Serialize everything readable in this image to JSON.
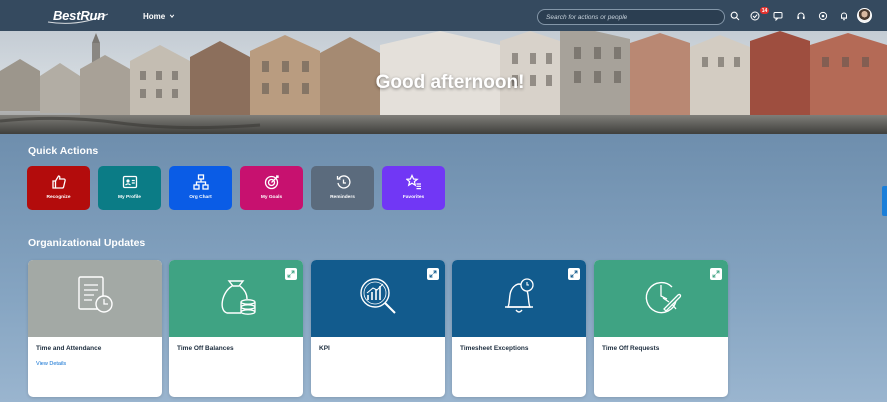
{
  "shell": {
    "logo": "BestRun",
    "home_menu": "Home",
    "search_placeholder": "Search for actions or people",
    "notification_count": "14",
    "icons": [
      "search-icon",
      "notification-check-icon",
      "chat-icon",
      "headset-icon",
      "settings-icon",
      "bell-icon"
    ]
  },
  "hero": {
    "greeting": "Good afternoon!"
  },
  "quick_actions": {
    "title": "Quick Actions",
    "items": [
      {
        "label": "Recognize",
        "icon": "thumbs-up-icon",
        "color": "#b30c0c"
      },
      {
        "label": "My Profile",
        "icon": "profile-card-icon",
        "color": "#0b7c86"
      },
      {
        "label": "Org Chart",
        "icon": "org-chart-icon",
        "color": "#0a5ce6"
      },
      {
        "label": "My Goals",
        "icon": "target-icon",
        "color": "#c7116f"
      },
      {
        "label": "Reminders",
        "icon": "reminder-icon",
        "color": "#5b6b7d"
      },
      {
        "label": "Favorites",
        "icon": "star-list-icon",
        "color": "#7137f5"
      }
    ]
  },
  "org_updates": {
    "title": "Organizational Updates",
    "cards": [
      {
        "title": "Time and Attendance",
        "link": "View Details",
        "icon": "timesheet-icon",
        "color": "#a3a9a5"
      },
      {
        "title": "Time Off Balances",
        "icon": "money-bag-icon",
        "color": "#3fa383"
      },
      {
        "title": "KPI",
        "icon": "kpi-magnifier-icon",
        "color": "#125b8d"
      },
      {
        "title": "Timesheet Exceptions",
        "icon": "alarm-bell-icon",
        "color": "#125b8d"
      },
      {
        "title": "Time Off Requests",
        "icon": "travel-clock-icon",
        "color": "#3fa383"
      }
    ]
  }
}
